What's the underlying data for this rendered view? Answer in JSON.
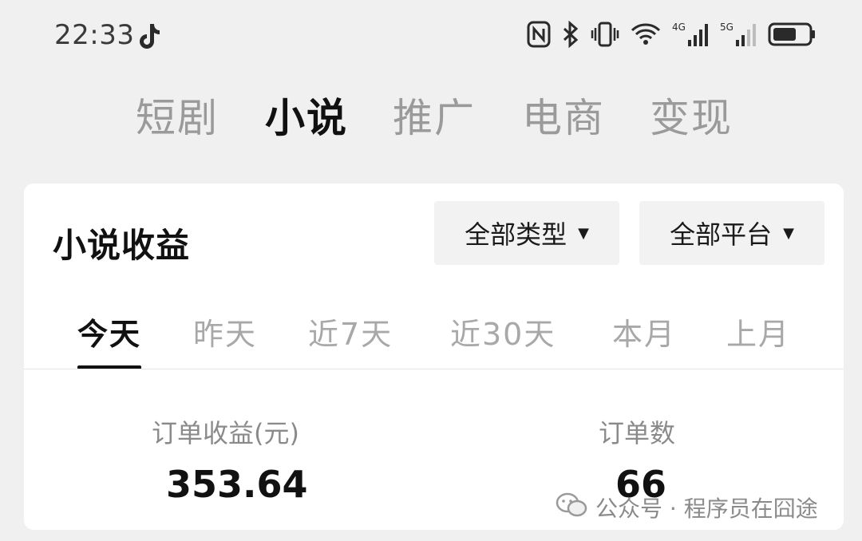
{
  "status_bar": {
    "time": "22:33",
    "signal_4g": "4G",
    "signal_5g": "5G",
    "icons": [
      "tiktok-icon",
      "nfc-icon",
      "bluetooth-icon",
      "vibrate-icon",
      "wifi-icon",
      "signal-icon",
      "battery-icon"
    ]
  },
  "top_tabs": {
    "items": [
      {
        "label": "短剧",
        "active": false
      },
      {
        "label": "小说",
        "active": true
      },
      {
        "label": "推广",
        "active": false
      },
      {
        "label": "电商",
        "active": false
      },
      {
        "label": "变现",
        "active": false
      }
    ]
  },
  "card": {
    "title": "小说收益",
    "filters": [
      {
        "label": "全部类型"
      },
      {
        "label": "全部平台"
      }
    ],
    "period_tabs": [
      {
        "label": "今天",
        "active": true
      },
      {
        "label": "昨天",
        "active": false
      },
      {
        "label": "近7天",
        "active": false
      },
      {
        "label": "近30天",
        "active": false
      },
      {
        "label": "本月",
        "active": false
      },
      {
        "label": "上月",
        "active": false
      }
    ],
    "metrics": [
      {
        "label": "订单收益(元)",
        "value": "353.64"
      },
      {
        "label": "订单数",
        "value": "66"
      }
    ]
  },
  "watermark": {
    "text": "公众号 · 程序员在囧途"
  },
  "colors": {
    "background": "#f0f0f0",
    "card": "#ffffff",
    "active_text": "#111111",
    "inactive_text": "#9a9a9a",
    "filter_bg": "#f2f2f2"
  }
}
